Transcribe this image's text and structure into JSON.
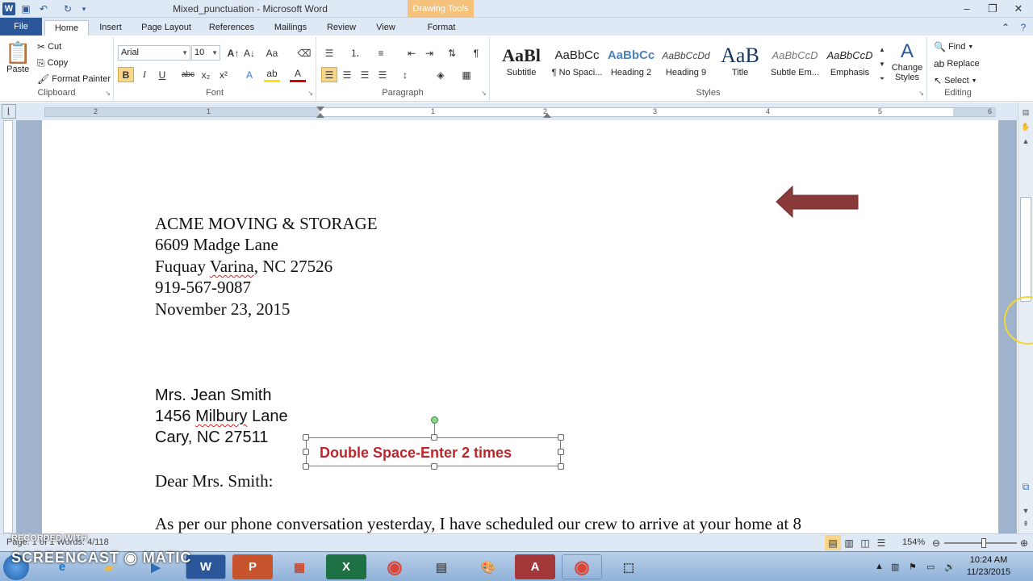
{
  "titlebar": {
    "word_logo": "W",
    "title": "Mixed_punctuation - Microsoft Word",
    "contextual_tab": "Drawing Tools",
    "minimize": "–",
    "restore": "❐",
    "close": "✕"
  },
  "tabs": [
    "File",
    "Home",
    "Insert",
    "Page Layout",
    "References",
    "Mailings",
    "Review",
    "View",
    "Format"
  ],
  "ribbon": {
    "clipboard": {
      "paste": "Paste",
      "cut": "Cut",
      "copy": "Copy",
      "format_painter": "Format Painter",
      "label": "Clipboard"
    },
    "font": {
      "name": "Arial",
      "size": "10",
      "label": "Font",
      "bold": "B",
      "italic": "I",
      "underline": "U",
      "strike": "abc",
      "subscript": "x₂",
      "superscript": "x²"
    },
    "paragraph": {
      "label": "Paragraph",
      "pilcrow": "¶"
    },
    "styles": {
      "label": "Styles",
      "items": [
        {
          "preview": "AaBl",
          "name": "Subtitle"
        },
        {
          "preview": "AaBbCc",
          "name": "¶ No Spaci..."
        },
        {
          "preview": "AaBbCc",
          "name": "Heading 2"
        },
        {
          "preview": "AaBbCcDd",
          "name": "Heading 9"
        },
        {
          "preview": "AaB",
          "name": "Title"
        },
        {
          "preview": "AaBbCcD",
          "name": "Subtle Em..."
        },
        {
          "preview": "AaBbCcD",
          "name": "Emphasis"
        }
      ],
      "change_styles": "Change Styles"
    },
    "editing": {
      "find": "Find",
      "replace": "Replace",
      "select": "Select",
      "label": "Editing"
    }
  },
  "ruler": {
    "numbers": [
      "2",
      "1",
      "1",
      "2",
      "3",
      "4",
      "5",
      "6"
    ]
  },
  "document": {
    "company": "ACME MOVING & STORAGE",
    "street": "6609 Madge Lane",
    "city_pre": "Fuquay ",
    "city_squig": "Varina",
    "city_post": ", NC  27526",
    "phone": "919-567-9087",
    "date": "November 23, 2015",
    "recipient": "Mrs. Jean Smith",
    "r_street_pre": "1456 ",
    "r_street_squig": "Milbury",
    "r_street_post": " Lane",
    "r_city": "Cary, NC 27511",
    "salutation": "Dear Mrs. Smith:",
    "body": "As per our phone conversation yesterday, I have scheduled our crew to arrive at your home at 8",
    "textbox": "Double Space-Enter 2 times"
  },
  "statusbar": {
    "words": "Page: 1 of 1    Words: 4/118",
    "zoom": "154%"
  },
  "screencast": {
    "recorded": "RECORDED WITH",
    "logo": "SCREENCAST ◉ MATIC"
  },
  "taskbar": {
    "time": "10:24 AM",
    "date": "11/23/2015"
  },
  "colors": {
    "arrow": "#8b3a3a",
    "textbox_text": "#c0252b",
    "file_tab": "#2b579a"
  }
}
